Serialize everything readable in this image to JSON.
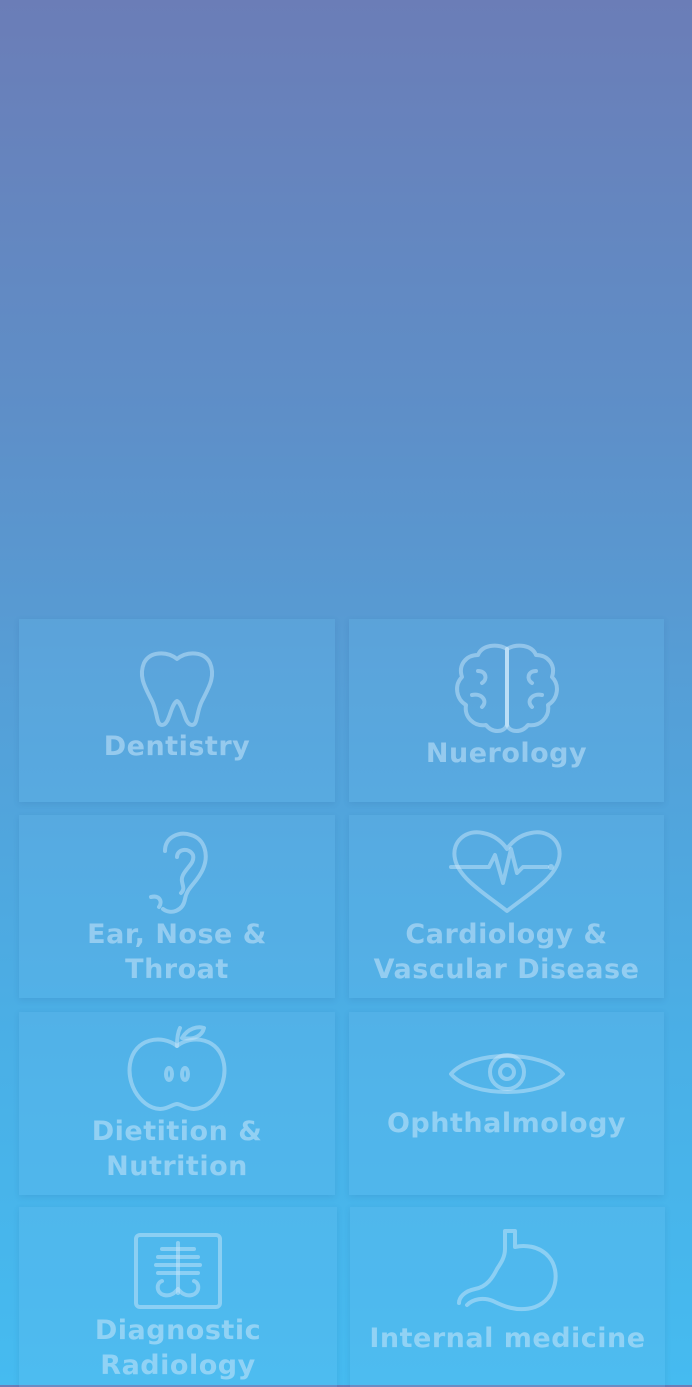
{
  "colors": {
    "background_top": "#6b7db7",
    "background_bottom": "#45bbf0",
    "tile_text": "#c8e6fa"
  },
  "specialties": [
    {
      "label": "Dentistry",
      "icon": "tooth-icon"
    },
    {
      "label": "Nuerology",
      "icon": "brain-icon"
    },
    {
      "label": "Ear, Nose &\nThroat",
      "icon": "ear-icon"
    },
    {
      "label": "Cardiology &\nVascular Disease",
      "icon": "heart-pulse-icon"
    },
    {
      "label": "Dietition &\nNutrition",
      "icon": "apple-icon"
    },
    {
      "label": "Ophthalmology",
      "icon": "eye-icon"
    },
    {
      "label": "Diagnostic\nRadiology",
      "icon": "xray-icon"
    },
    {
      "label": "Internal medicine",
      "icon": "stomach-icon"
    }
  ]
}
